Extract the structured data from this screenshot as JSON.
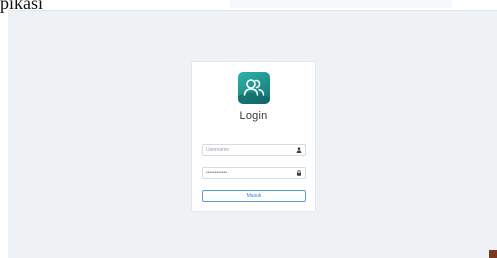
{
  "caption": "pikasi",
  "login": {
    "title": "Login",
    "username_placeholder": "Username",
    "password_value": "••••••••••••",
    "submit_label": "Masuk"
  },
  "icons": {
    "logo": "users-icon",
    "username": "user-icon",
    "password": "lock-icon"
  },
  "colors": {
    "background": "#eef2f5",
    "card": "#ffffff",
    "logo": "#1e8f8a",
    "button_border": "#5b9bd5"
  }
}
